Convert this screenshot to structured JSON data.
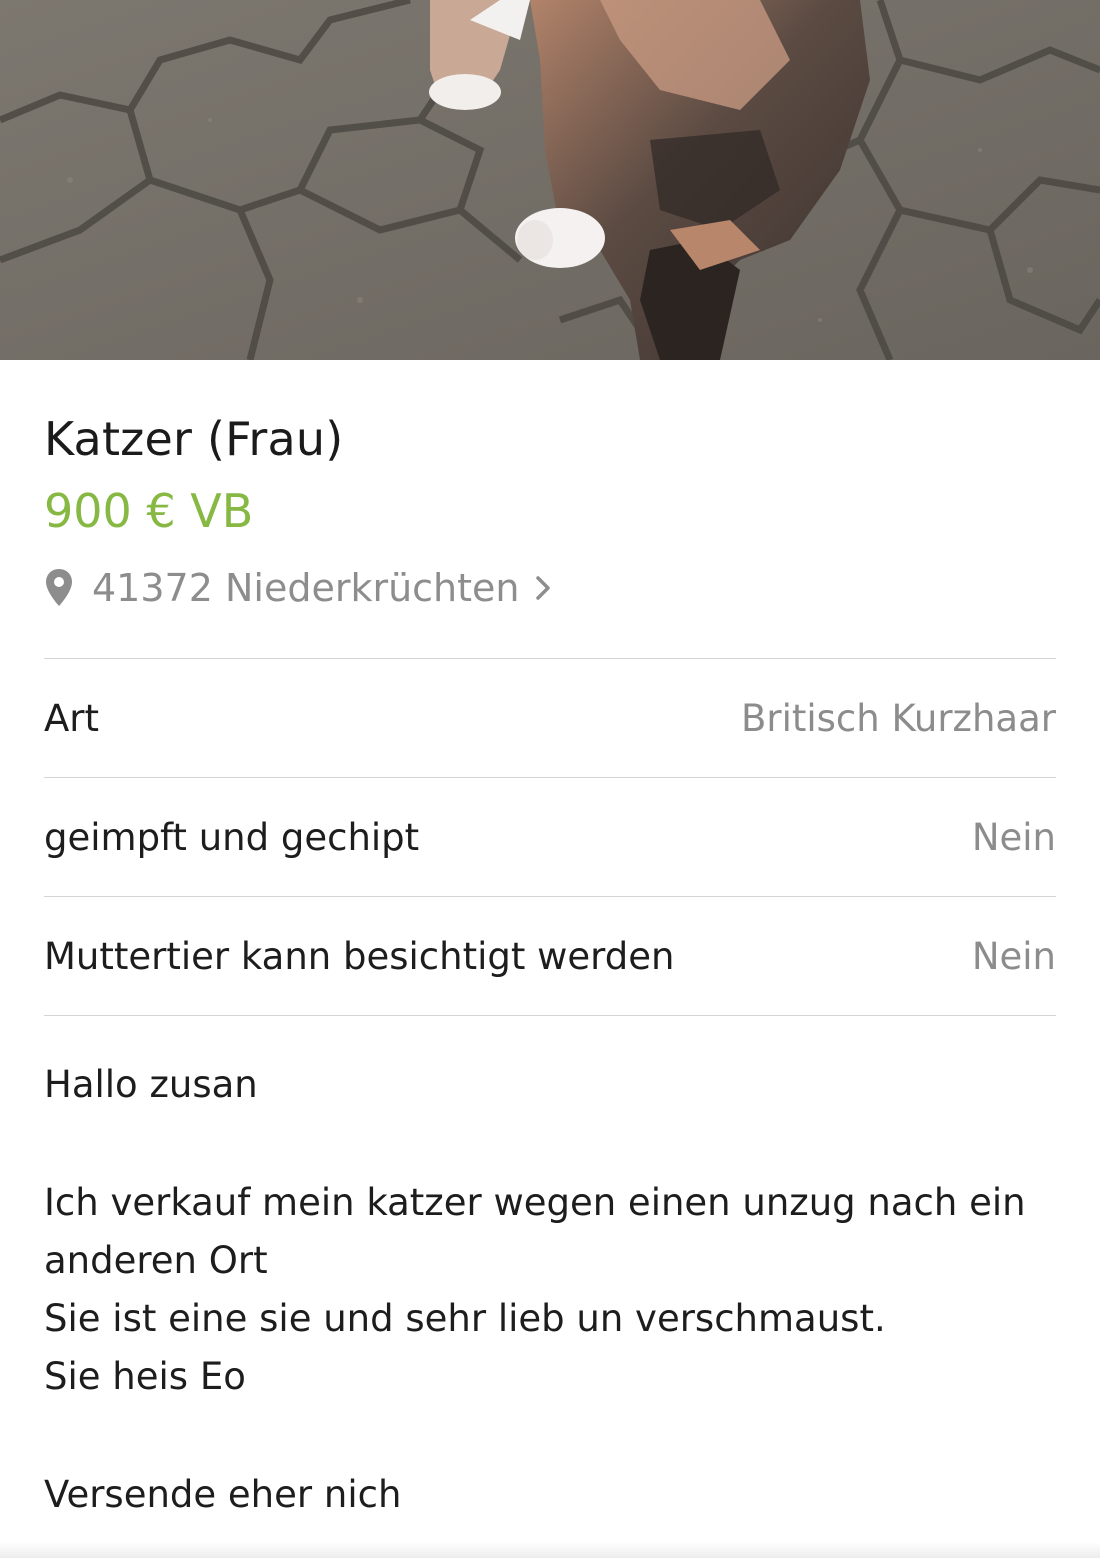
{
  "listing": {
    "title": "Katzer (Frau)",
    "price": "900 € VB",
    "location": "41372 Niederkrüchten",
    "attributes": [
      {
        "label": "Art",
        "value": "Britisch Kurzhaar"
      },
      {
        "label": "geimpft und gechipt",
        "value": "Nein"
      },
      {
        "label": "Muttertier kann besichtigt werden",
        "value": "Nein"
      }
    ],
    "description": {
      "greeting": "Hallo zusan",
      "line1": "Ich verkauf mein katzer wegen einen unzug nach ein",
      "line2": "anderen Ort",
      "line3": "Sie ist eine sie und sehr lieb un verschmaust.",
      "line4": "Sie heis Eo",
      "closing": "Versende eher nich"
    }
  },
  "icons": {
    "location": "map-pin-icon",
    "chevron": "chevron-right-icon"
  },
  "colors": {
    "price": "#86b843",
    "secondary_text": "#8d8d8d"
  }
}
